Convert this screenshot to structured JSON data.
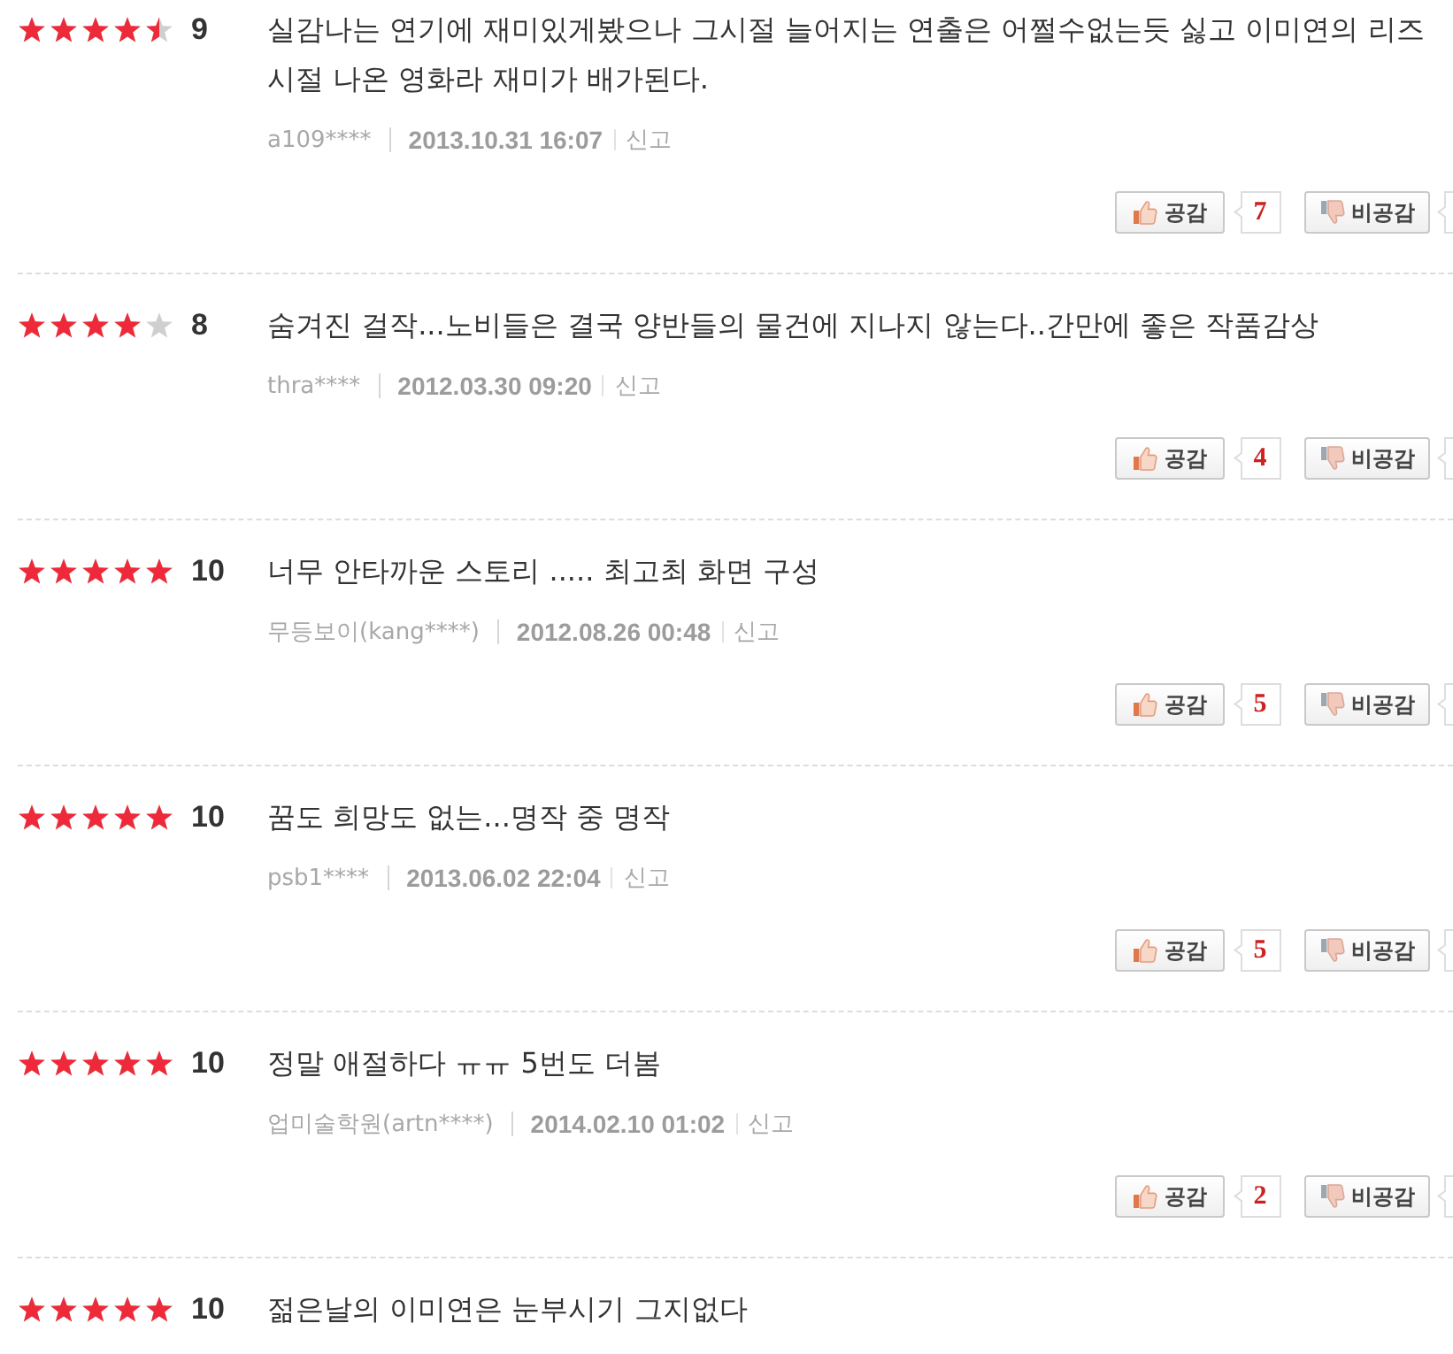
{
  "reviews": [
    {
      "stars": 4.5,
      "score": "9",
      "text": "실감나는 연기에 재미있게봤으나 그시절 늘어지는 연출은 어쩔수없는듯 싫고 이미연의 리즈 시절 나온 영화라 재미가 배가된다.",
      "user": "a109****",
      "date": "2013.10.31 16:07",
      "report": "신고",
      "like": {
        "label": "공감",
        "count": "7"
      },
      "dislike": {
        "label": "비공감"
      }
    },
    {
      "stars": 4,
      "score": "8",
      "text": "숨겨진 걸작...노비들은 결국 양반들의 물건에 지나지 않는다..간만에 좋은 작품감상",
      "user": "thra****",
      "date": "2012.03.30 09:20",
      "report": "신고",
      "like": {
        "label": "공감",
        "count": "4"
      },
      "dislike": {
        "label": "비공감"
      }
    },
    {
      "stars": 5,
      "score": "10",
      "text": "너무 안타까운 스토리 ..... 최고최 화면 구성",
      "user": "무등보이(kang****)",
      "date": "2012.08.26 00:48",
      "report": "신고",
      "like": {
        "label": "공감",
        "count": "5"
      },
      "dislike": {
        "label": "비공감"
      }
    },
    {
      "stars": 5,
      "score": "10",
      "text": "꿈도 희망도 없는...명작 중 명작",
      "user": "psb1****",
      "date": "2013.06.02 22:04",
      "report": "신고",
      "like": {
        "label": "공감",
        "count": "5"
      },
      "dislike": {
        "label": "비공감"
      }
    },
    {
      "stars": 5,
      "score": "10",
      "text": "정말 애절하다 ㅠㅠ 5번도 더봄",
      "user": "업미술학원(artn****)",
      "date": "2014.02.10 01:02",
      "report": "신고",
      "like": {
        "label": "공감",
        "count": "2"
      },
      "dislike": {
        "label": "비공감"
      }
    },
    {
      "stars": 5,
      "score": "10",
      "text": "젊은날의 이미연은 눈부시기 그지없다"
    }
  ]
}
